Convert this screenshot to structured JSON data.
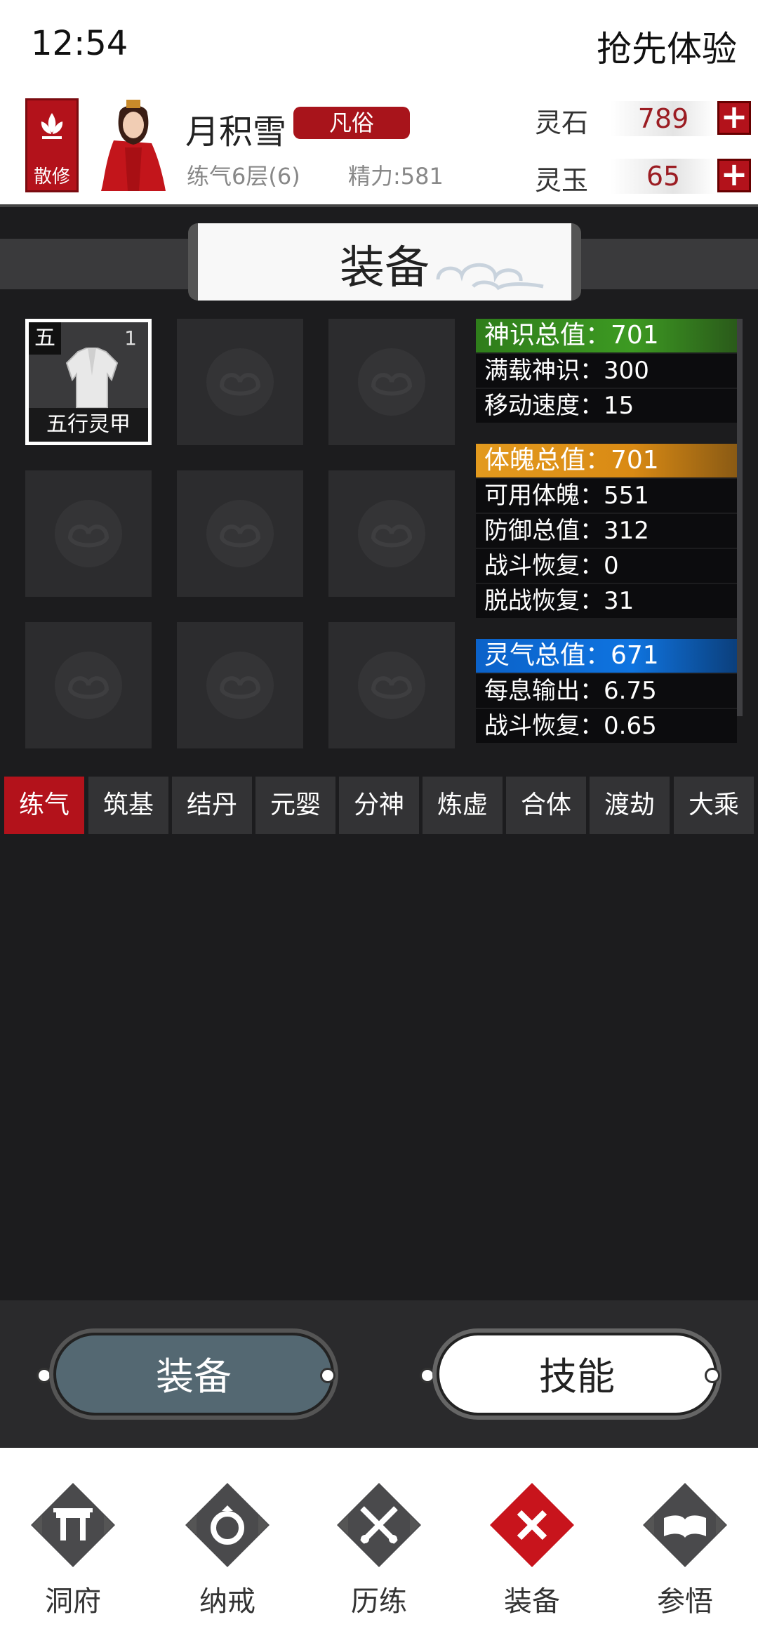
{
  "statusbar": {
    "time": "12:54",
    "right_text": "抢先体验"
  },
  "player": {
    "sect": "散修",
    "name": "月积雪",
    "rank": "凡俗",
    "level": "练气6层(6)",
    "energy": "精力:581"
  },
  "currency": [
    {
      "label": "灵石",
      "value": "789"
    },
    {
      "label": "灵玉",
      "value": "65"
    }
  ],
  "page_title": "装备",
  "equipment": {
    "slots": [
      {
        "tier": "五",
        "count": "1",
        "name": "五行灵甲"
      }
    ]
  },
  "stats": {
    "divine": {
      "header": "神识总值：701",
      "rows": [
        "满载神识：300",
        "移动速度：15"
      ]
    },
    "body": {
      "header": "体魄总值：701",
      "rows": [
        "可用体魄：551",
        "防御总值：312",
        "战斗恢复：0",
        "脱战恢复：31"
      ]
    },
    "qi": {
      "header": "灵气总值：671",
      "rows": [
        "每息输出：6.75",
        "战斗恢复：0.65"
      ]
    },
    "colors": {
      "divine": "#2f7d1b",
      "body": "#e39a1e",
      "qi": "#0b62c9"
    }
  },
  "tabs": [
    "练气",
    "筑基",
    "结丹",
    "元婴",
    "分神",
    "炼虚",
    "合体",
    "渡劫",
    "大乘"
  ],
  "actions": {
    "equip": "装备",
    "skill": "技能"
  },
  "nav": [
    {
      "label": "洞府",
      "icon": "gate-icon"
    },
    {
      "label": "纳戒",
      "icon": "ring-icon"
    },
    {
      "label": "历练",
      "icon": "crossed-swords-icon"
    },
    {
      "label": "装备",
      "icon": "close-icon"
    },
    {
      "label": "参悟",
      "icon": "book-icon"
    }
  ]
}
